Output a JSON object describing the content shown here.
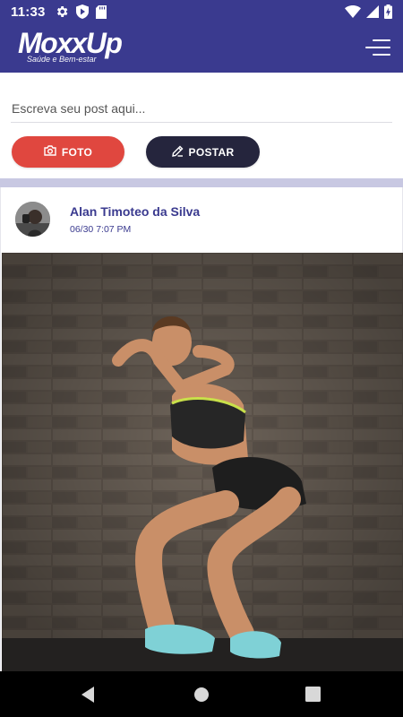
{
  "status_bar": {
    "time": "11:33",
    "icons_left": [
      "gear-icon",
      "shield-play-icon",
      "sd-card-icon"
    ],
    "icons_right": [
      "wifi-icon",
      "signal-icon",
      "battery-charging-icon"
    ]
  },
  "app_bar": {
    "logo_text": "MoxxUp",
    "logo_subtitle": "Saúde e Bem-estar",
    "menu_icon": "menu-icon"
  },
  "composer": {
    "placeholder": "Escreva seu post aqui...",
    "value": "",
    "photo_button_label": "FOTO",
    "photo_icon": "camera-icon",
    "post_button_label": "POSTAR",
    "post_icon": "pencil-icon"
  },
  "feed": {
    "posts": [
      {
        "author": "Alan Timoteo da Silva",
        "date": "06/30 7:07 PM",
        "avatar": "avatar-photo",
        "image": "woman-squat-exercise-photo"
      }
    ]
  },
  "nav_bar": {
    "buttons": [
      "back-icon",
      "home-icon",
      "recents-icon"
    ]
  },
  "colors": {
    "brand": "#3a3a8f",
    "photo_button": "#e0473f",
    "post_button": "#25253d",
    "divider": "#c8c8e2"
  }
}
